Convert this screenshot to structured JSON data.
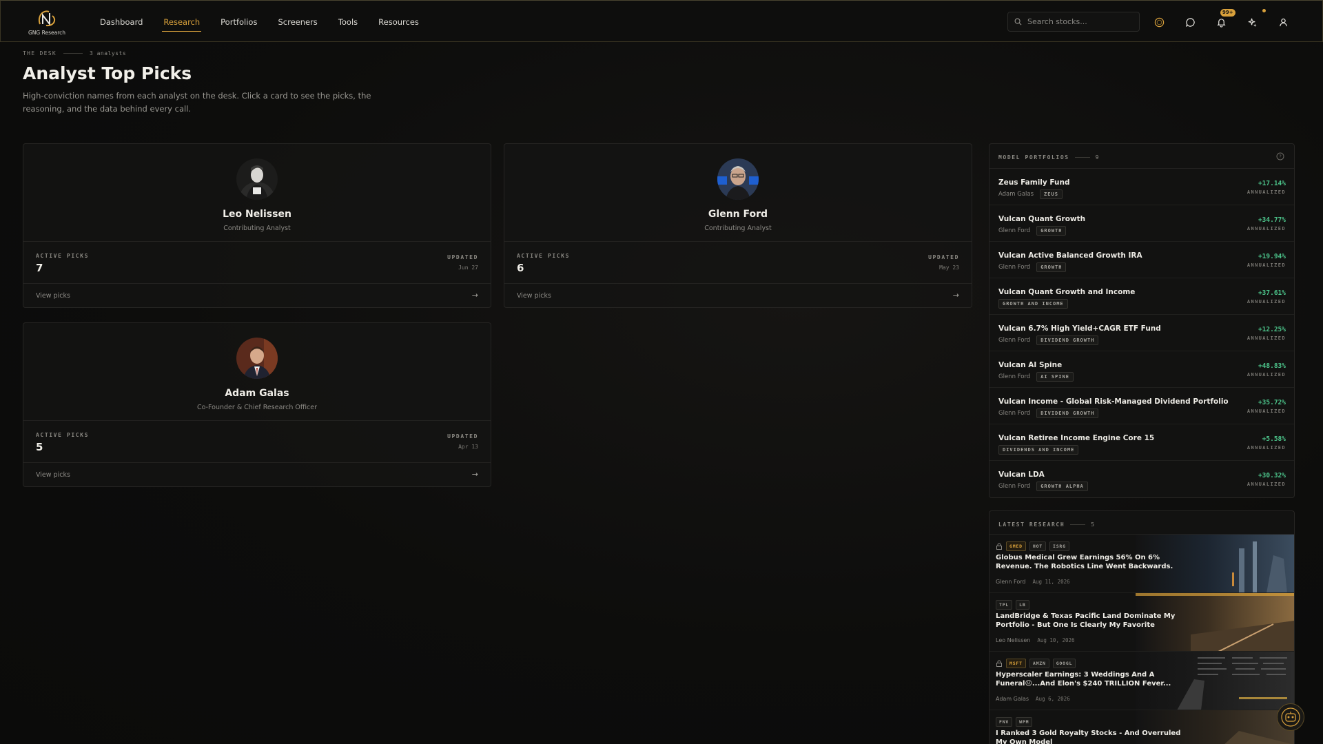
{
  "brand": {
    "name": "GNG Research"
  },
  "nav": {
    "items": [
      {
        "label": "Dashboard",
        "active": false
      },
      {
        "label": "Research",
        "active": true
      },
      {
        "label": "Portfolios",
        "active": false
      },
      {
        "label": "Screeners",
        "active": false
      },
      {
        "label": "Tools",
        "active": false
      },
      {
        "label": "Resources",
        "active": false
      }
    ]
  },
  "header": {
    "search_placeholder": "Search stocks...",
    "notification_badge": "99+",
    "icons": [
      "search-icon",
      "coin-icon",
      "chat-icon",
      "bell-icon",
      "sparkle-icon",
      "user-icon"
    ]
  },
  "page": {
    "eyebrow": "THE DESK",
    "eyebrow_count": "3 analysts",
    "title": "Analyst Top Picks",
    "description": "High-conviction names from each analyst on the desk. Click a card to see the picks, the reasoning, and the data behind every call."
  },
  "labels": {
    "active_picks": "ACTIVE PICKS",
    "updated": "UPDATED",
    "view_picks": "View picks",
    "annualized": "ANNUALIZED"
  },
  "analysts": [
    {
      "name": "Leo Nelissen",
      "role": "Contributing Analyst",
      "active_picks": "7",
      "updated": "Jun 27"
    },
    {
      "name": "Glenn Ford",
      "role": "Contributing Analyst",
      "active_picks": "6",
      "updated": "May 23"
    },
    {
      "name": "Adam Galas",
      "role": "Co-Founder & Chief Research Officer",
      "active_picks": "5",
      "updated": "Apr 13"
    }
  ],
  "model_portfolios": {
    "title": "MODEL PORTFOLIOS",
    "count": "9",
    "items": [
      {
        "name": "Zeus Family Fund",
        "author": "Adam Galas",
        "tag": "ZEUS",
        "return": "+17.14%"
      },
      {
        "name": "Vulcan Quant Growth",
        "author": "Glenn Ford",
        "tag": "GROWTH",
        "return": "+34.77%"
      },
      {
        "name": "Vulcan Active Balanced Growth IRA",
        "author": "Glenn Ford",
        "tag": "GROWTH",
        "return": "+19.94%"
      },
      {
        "name": "Vulcan Quant Growth and Income",
        "author": "",
        "tag": "GROWTH AND INCOME",
        "return": "+37.61%"
      },
      {
        "name": "Vulcan 6.7% High Yield+CAGR ETF Fund",
        "author": "Glenn Ford",
        "tag": "DIVIDEND GROWTH",
        "return": "+12.25%"
      },
      {
        "name": "Vulcan AI Spine",
        "author": "Glenn Ford",
        "tag": "AI SPINE",
        "return": "+48.83%"
      },
      {
        "name": "Vulcan Income - Global Risk-Managed Dividend Portfolio",
        "author": "Glenn Ford",
        "tag": "DIVIDEND GROWTH",
        "return": "+35.72%"
      },
      {
        "name": "Vulcan Retiree Income Engine Core 15",
        "author": "",
        "tag": "DIVIDENDS AND INCOME",
        "return": "+5.58%"
      },
      {
        "name": "Vulcan LDA",
        "author": "Glenn Ford",
        "tag": "GROWTH ALPHA",
        "return": "+30.32%"
      }
    ]
  },
  "latest_research": {
    "title": "LATEST RESEARCH",
    "count": "5",
    "items": [
      {
        "locked": true,
        "tags": [
          "GMED",
          "HOT",
          "ISRG"
        ],
        "title": "Globus Medical Grew Earnings 56% On 6% Revenue. The Robotics Line Went Backwards.",
        "author": "Glenn Ford",
        "date": "Aug 11, 2026"
      },
      {
        "locked": false,
        "tags": [
          "TPL",
          "LB"
        ],
        "title": "LandBridge & Texas Pacific Land Dominate My Portfolio - But One Is Clearly My Favorite",
        "author": "Leo Nelissen",
        "date": "Aug 10, 2026"
      },
      {
        "locked": true,
        "tags": [
          "MSFT",
          "AMZN",
          "GOOGL"
        ],
        "title": "Hyperscaler Earnings: 3 Weddings And A Funeral😐...And Elon's $240 TRILLION Fever...",
        "author": "Adam Galas",
        "date": "Aug 6, 2026"
      },
      {
        "locked": false,
        "tags": [
          "FNV",
          "WPM"
        ],
        "title": "I Ranked 3 Gold Royalty Stocks - And Overruled My Own Model",
        "author": "",
        "date": ""
      }
    ]
  },
  "colors": {
    "accent": "#d9a13b",
    "positive": "#4cc38a",
    "background": "#0d0d0c"
  }
}
